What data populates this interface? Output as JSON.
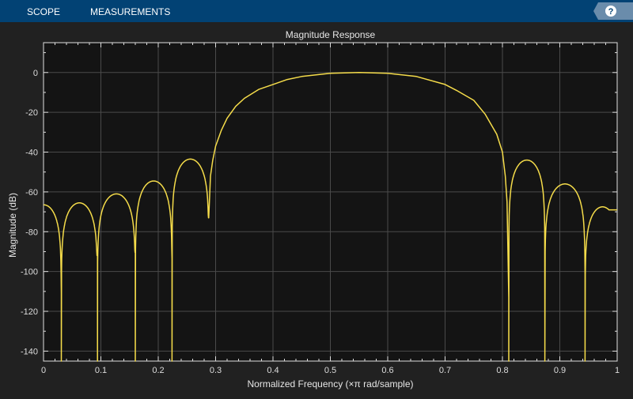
{
  "toolbar": {
    "tabs": [
      "SCOPE",
      "MEASUREMENTS"
    ],
    "help_label": "?"
  },
  "colors": {
    "toolbar": "#024274",
    "background": "#212121",
    "plot_bg": "#141414",
    "line": "#f5dc4a",
    "grid": "#4a4a4a"
  },
  "chart_data": {
    "type": "line",
    "title": "Magnitude Response",
    "xlabel": "Normalized Frequency (×π rad/sample)",
    "ylabel": "Magnitude (dB)",
    "xlim": [
      0,
      1
    ],
    "ylim": [
      -145,
      15
    ],
    "xticks": [
      "0",
      "0.1",
      "0.2",
      "0.3",
      "0.4",
      "0.5",
      "0.6",
      "0.7",
      "0.8",
      "0.9",
      "1"
    ],
    "yticks": [
      "0",
      "-20",
      "-40",
      "-60",
      "-80",
      "-100",
      "-120",
      "-140"
    ],
    "grid": true,
    "series": [
      {
        "name": "Magnitude",
        "stopband_lobes": [
          {
            "null_left": -0.03,
            "null_right": 0.031,
            "peak": -66.5,
            "depth_right": -111
          },
          {
            "null_left": 0.031,
            "null_right": 0.094,
            "peak": -65.5,
            "depth_right": -92
          },
          {
            "null_left": 0.094,
            "null_right": 0.16,
            "peak": -61,
            "depth_right": -90.5
          },
          {
            "null_left": 0.16,
            "null_right": 0.224,
            "peak": -54.5,
            "depth_right": -93.5
          },
          {
            "null_left": 0.224,
            "null_right": 0.288,
            "peak": -43.5,
            "depth_right": -73
          },
          {
            "null_left": 0.811,
            "null_right": 0.874,
            "peak": -44,
            "depth_right": -128.5
          },
          {
            "null_left": 0.874,
            "null_right": 0.944,
            "peak": -56,
            "depth_right": -101.5
          },
          {
            "null_left": 0.944,
            "null_right": 1.005,
            "peak": -67.5,
            "depth_right": -69
          }
        ],
        "passband_points": [
          [
            0.288,
            -73
          ],
          [
            0.291,
            -52
          ],
          [
            0.295,
            -44
          ],
          [
            0.3,
            -37
          ],
          [
            0.31,
            -29
          ],
          [
            0.32,
            -23
          ],
          [
            0.335,
            -17
          ],
          [
            0.35,
            -13
          ],
          [
            0.375,
            -8.5
          ],
          [
            0.4,
            -6
          ],
          [
            0.425,
            -3.5
          ],
          [
            0.45,
            -2
          ],
          [
            0.5,
            -0.4
          ],
          [
            0.55,
            0
          ],
          [
            0.6,
            -0.4
          ],
          [
            0.65,
            -2
          ],
          [
            0.7,
            -6
          ],
          [
            0.72,
            -9
          ],
          [
            0.75,
            -14
          ],
          [
            0.77,
            -21
          ],
          [
            0.78,
            -26
          ],
          [
            0.79,
            -31
          ],
          [
            0.8,
            -40
          ],
          [
            0.805,
            -52
          ],
          [
            0.808,
            -65
          ],
          [
            0.811,
            -113
          ]
        ]
      }
    ]
  }
}
